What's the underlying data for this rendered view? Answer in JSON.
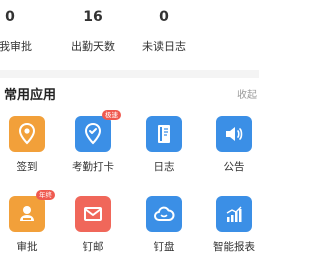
{
  "stats": [
    {
      "value": "0",
      "label": "待我审批"
    },
    {
      "value": "16",
      "label": "出勤天数"
    },
    {
      "value": "0",
      "label": "未读日志"
    }
  ],
  "section": {
    "title": "常用应用",
    "collapse_label": "收起"
  },
  "apps": [
    {
      "label": "签到",
      "icon": "location-pin-icon",
      "color": "#f2a03a",
      "badge": ""
    },
    {
      "label": "考勤打卡",
      "icon": "check-location-icon",
      "color": "#3b8fe6",
      "badge": "极速"
    },
    {
      "label": "日志",
      "icon": "notebook-icon",
      "color": "#3b8fe6",
      "badge": ""
    },
    {
      "label": "公告",
      "icon": "speaker-icon",
      "color": "#3b8fe6",
      "badge": ""
    },
    {
      "label": "审批",
      "icon": "person-stamp-icon",
      "color": "#f2a03a",
      "badge": "年终"
    },
    {
      "label": "钉邮",
      "icon": "mail-icon",
      "color": "#f0675a",
      "badge": ""
    },
    {
      "label": "钉盘",
      "icon": "cloud-icon",
      "color": "#3b8fe6",
      "badge": ""
    },
    {
      "label": "智能报表",
      "icon": "bar-chart-icon",
      "color": "#3b8fe6",
      "badge": ""
    }
  ]
}
